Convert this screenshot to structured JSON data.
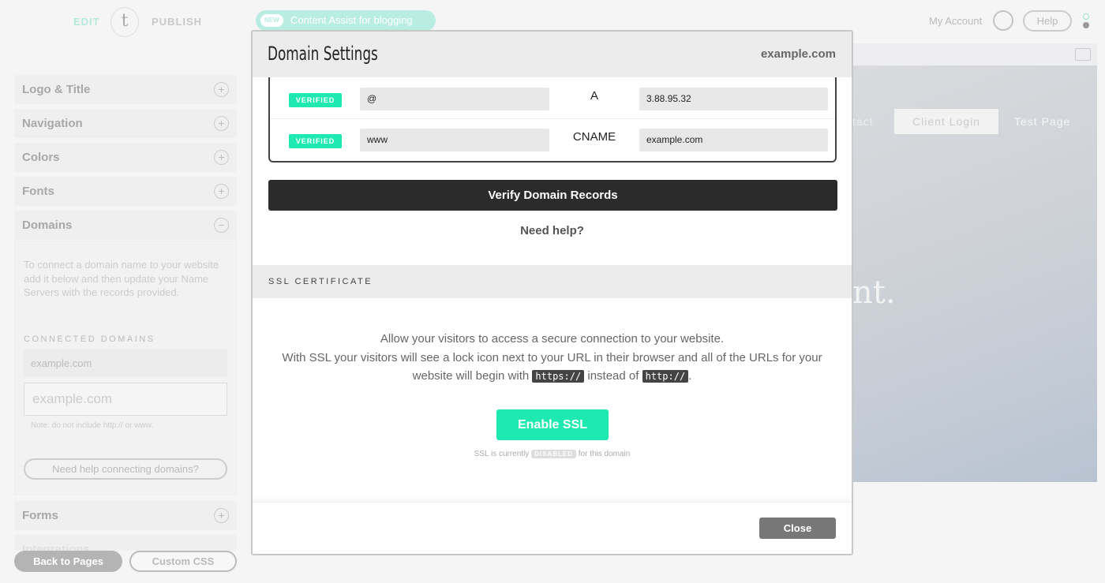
{
  "topbar": {
    "edit": "EDIT",
    "logo": "t",
    "publish": "PUBLISH",
    "promo_badge": "NEW",
    "promo_text": "Content Assist for blogging",
    "account": "My Account",
    "help": "Help"
  },
  "sidebar": {
    "sections": [
      {
        "label": "Logo & Title",
        "icon": "plus"
      },
      {
        "label": "Navigation",
        "icon": "plus"
      },
      {
        "label": "Colors",
        "icon": "plus"
      },
      {
        "label": "Fonts",
        "icon": "plus"
      },
      {
        "label": "Domains",
        "icon": "minus"
      },
      {
        "label": "Forms",
        "icon": "plus"
      },
      {
        "label": "Integrations",
        "icon": "plus"
      }
    ],
    "domains": {
      "description": "To connect a domain name to your website add it below and then update your Name Servers with the records provided.",
      "connected_label": "CONNECTED DOMAINS",
      "connected": "example.com",
      "input_placeholder": "example.com",
      "note": "Note: do not include http:// or www.",
      "help_button": "Need help connecting domains?"
    },
    "back": "Back to Pages",
    "custom_css": "Custom CSS"
  },
  "preview": {
    "nav": [
      "tact",
      "Client Login",
      "Test Page"
    ],
    "hero": "nt."
  },
  "modal": {
    "title": "Domain Settings",
    "domain": "example.com",
    "records": [
      {
        "status": "VERIFIED",
        "host": "@",
        "type": "A",
        "value": "3.88.95.32"
      },
      {
        "status": "VERIFIED",
        "host": "www",
        "type": "CNAME",
        "value": "example.com"
      }
    ],
    "verify": "Verify Domain Records",
    "need_help": "Need help?",
    "ssl": {
      "heading": "SSL CERTIFICATE",
      "line1": "Allow your visitors to access a secure connection to your website.",
      "line2": "With SSL your visitors will see a lock icon next to your URL in their browser and all of the URLs for your",
      "line3a": "website will begin with",
      "https": "https://",
      "line3b": "instead of",
      "http": "http://",
      "line3c": ".",
      "button": "Enable SSL",
      "status_a": "SSL is currently",
      "status": "DISABLED",
      "status_b": "for this domain"
    },
    "close": "Close"
  },
  "colors": {
    "accent": "#1de9b0",
    "dark": "#2b2b2b"
  }
}
